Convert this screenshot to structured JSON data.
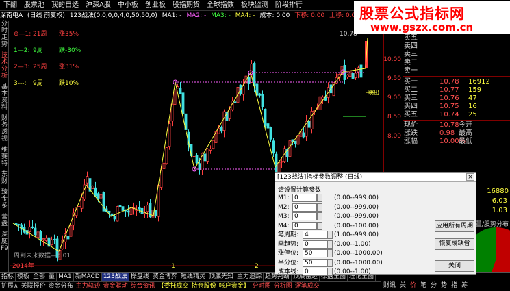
{
  "top_menu": [
    "下翻",
    "股票池",
    "我的自选",
    "沪深A股",
    "中小板",
    "创业板",
    "股指期货",
    "全球指数",
    "板块监测",
    "阶段排行"
  ],
  "info_bar": {
    "stock_name": "深南电A",
    "period": "(日线 前复权)",
    "indicator": "123战法(0,0,0,0,4,0,50,50,0)",
    "ma1": "MA1: -",
    "ma2": "MA2: -",
    "ma3": "MA3: -",
    "ma4": "MA4: -",
    "cost": "成本: 0.00",
    "down_move": "下移: 0.00",
    "up_move": "上移: 0.00"
  },
  "left_bar": [
    {
      "label": "分时走势",
      "active": false
    },
    {
      "label": "技术分析",
      "active": true
    },
    {
      "label": "基本资料",
      "active": false
    },
    {
      "label": "财务透视",
      "active": false
    },
    {
      "label": "维赛特",
      "active": false
    },
    {
      "label": "东财",
      "active": false
    },
    {
      "label": "臻金系",
      "active": false
    },
    {
      "label": "营盘",
      "active": false
    },
    {
      "label": "深度F9",
      "active": false
    }
  ],
  "legend": [
    {
      "label": "⊕—1:",
      "period": "21周",
      "change": "涨35%",
      "color": "#ff4040"
    },
    {
      "label": "1—2:",
      "period": "9周",
      "change": "跌-30%",
      "color": "#40ff40"
    },
    {
      "label": "2—3:",
      "period": "25周",
      "change": "涨31%",
      "color": "#ff4040"
    },
    {
      "label": "3---:",
      "period": "9周",
      "change": "跌10%",
      "color": "#ffff40"
    }
  ],
  "chart_annotations": {
    "top_price": "10.78",
    "bottom_text": "周到未来数据—5.01",
    "year_label": "2014年",
    "mark_1": "1",
    "mark_2": "2",
    "break_label": "跳出"
  },
  "right_axis": [
    "10.00",
    "9.50",
    "9.00",
    "8.50",
    "8.00"
  ],
  "quote": {
    "sells": [
      {
        "label": "卖五",
        "price": "",
        "vol": ""
      },
      {
        "label": "卖四",
        "price": "",
        "vol": ""
      },
      {
        "label": "卖三",
        "price": "",
        "vol": ""
      },
      {
        "label": "卖二",
        "price": "",
        "vol": ""
      },
      {
        "label": "卖一",
        "price": "",
        "vol": ""
      }
    ],
    "buys": [
      {
        "label": "买一",
        "price": "10.78",
        "vol": "16912"
      },
      {
        "label": "买二",
        "price": "10.77",
        "vol": "159"
      },
      {
        "label": "买三",
        "price": "10.76",
        "vol": "47"
      },
      {
        "label": "买四",
        "price": "10.75",
        "vol": "16"
      },
      {
        "label": "买五",
        "price": "10.74",
        "vol": "25"
      }
    ],
    "stats": [
      {
        "label": "现价",
        "value": "10.78",
        "label2": "今开",
        "value2": ""
      },
      {
        "label": "涨跌",
        "value": "0.98",
        "label2": "最高",
        "value2": ""
      },
      {
        "label": "涨幅",
        "value": "10.00%",
        "label2": "最低",
        "value2": ""
      }
    ],
    "volume_1": "16880",
    "value_603": "6.03",
    "value_103": "1.03",
    "tab_label": "量/股势分布"
  },
  "dialog": {
    "title": "[123战法]指标参数调整 (日线)",
    "close": "×",
    "hint": "请设置计算参数:",
    "params": [
      {
        "name": "M1:",
        "value": "0",
        "range": "(0.00--999.00)"
      },
      {
        "name": "M2:",
        "value": "0",
        "range": "(0.00--999.00)"
      },
      {
        "name": "M3:",
        "value": "0",
        "range": "(0.00--999.00)"
      },
      {
        "name": "M4:",
        "value": "0",
        "range": "(0.00--100.00)"
      },
      {
        "name": "笔周期:",
        "value": "4",
        "range": "(1.00--999.00)"
      },
      {
        "name": "画趋势:",
        "value": "0",
        "range": "(0.00--1.00)"
      },
      {
        "name": "涨停位:",
        "value": "50",
        "range": "(0.00--1000.00)"
      },
      {
        "name": "半分位:",
        "value": "50",
        "range": "(0.00--1000.00)"
      },
      {
        "name": "成本线:",
        "value": "0",
        "range": "(0.00--1.00)"
      }
    ],
    "buttons": [
      "应用所有周期",
      "恢复成缺省",
      "关闭"
    ]
  },
  "tabs": [
    "指标",
    "模板",
    "全部",
    "量",
    "MA1",
    "新MACD",
    "123战法",
    "操盘线",
    "资金博弈",
    "短线精灵",
    "顶底先知",
    "主力追踪",
    "趋势判断",
    "顶底雷达",
    "操盘王图",
    "理论王图"
  ],
  "active_tab": "123战法",
  "bottom_bar": [
    {
      "label": "扩展∧",
      "color": "#dddddd"
    },
    {
      "label": "关联报价",
      "color": "#dddddd"
    },
    {
      "label": "资金分布",
      "color": "#dddddd"
    },
    {
      "label": "主力轨迹",
      "color": "#ff5050"
    },
    {
      "label": "资金驱动",
      "color": "#ff5050"
    },
    {
      "label": "综合资讯",
      "color": "#ff5050"
    },
    {
      "label": "【委托成交",
      "color": "#ffff40"
    },
    {
      "label": "持仓股份",
      "color": "#ffff40"
    },
    {
      "label": "帐户资金】",
      "color": "#ffff40"
    },
    {
      "label": "分时图",
      "color": "#ff5050"
    },
    {
      "label": "分析图",
      "color": "#ff5050"
    },
    {
      "label": "逐笔成交",
      "color": "#ff5050"
    }
  ],
  "right_tabs": [
    "财讯",
    "关",
    "价",
    "笔",
    "分",
    "势",
    "指",
    "筹"
  ],
  "colors": {
    "up": "#ff4040",
    "down": "#40e0e0",
    "zigzag": "#ffff40",
    "bg": "#000000"
  }
}
